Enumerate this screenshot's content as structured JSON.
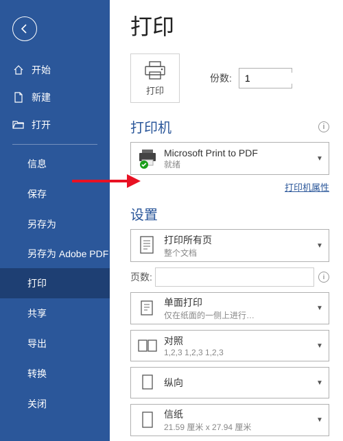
{
  "page_title": "打印",
  "sidebar": {
    "topItems": [
      {
        "label": "开始"
      },
      {
        "label": "新建"
      },
      {
        "label": "打开"
      }
    ],
    "subItems": [
      {
        "label": "信息",
        "selected": false
      },
      {
        "label": "保存",
        "selected": false
      },
      {
        "label": "另存为",
        "selected": false
      },
      {
        "label": "另存为 Adobe PDF",
        "selected": false
      },
      {
        "label": "打印",
        "selected": true
      },
      {
        "label": "共享",
        "selected": false
      },
      {
        "label": "导出",
        "selected": false
      },
      {
        "label": "转换",
        "selected": false
      },
      {
        "label": "关闭",
        "selected": false
      }
    ]
  },
  "print_button_label": "打印",
  "copies": {
    "label": "份数:",
    "value": "1"
  },
  "printer": {
    "section_label": "打印机",
    "selected_name": "Microsoft Print to PDF",
    "status": "就绪",
    "properties_link": "打印机属性"
  },
  "settings": {
    "section_label": "设置",
    "pages": {
      "main": "打印所有页",
      "sub": "整个文档"
    },
    "pages_range_label": "页数:",
    "pages_range_value": "",
    "sides": {
      "main": "单面打印",
      "sub": "仅在纸面的一侧上进行…"
    },
    "collate": {
      "main": "对照",
      "sub": "1,2,3   1,2,3   1,2,3"
    },
    "orientation": {
      "main": "纵向",
      "sub": ""
    },
    "paper": {
      "main": "信纸",
      "sub": "21.59 厘米 x 27.94 厘米"
    }
  }
}
